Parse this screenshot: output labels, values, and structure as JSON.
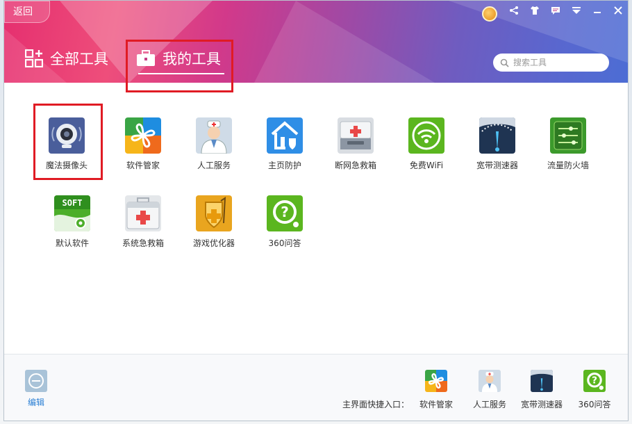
{
  "header": {
    "back_label": "返回",
    "tab_all": "全部工具",
    "tab_mine": "我的工具",
    "search_placeholder": "搜索工具"
  },
  "window_controls": [
    "medal-icon",
    "share-icon",
    "shirt-icon",
    "chat-icon",
    "menu-icon",
    "minimize-icon",
    "close-icon"
  ],
  "tools": [
    {
      "label": "魔法摄像头",
      "icon": "webcam-icon"
    },
    {
      "label": "软件管家",
      "icon": "software-manager-icon"
    },
    {
      "label": "人工服务",
      "icon": "doctor-icon"
    },
    {
      "label": "主页防护",
      "icon": "home-shield-icon"
    },
    {
      "label": "断网急救箱",
      "icon": "network-firstaid-icon"
    },
    {
      "label": "免费WiFi",
      "icon": "wifi-icon"
    },
    {
      "label": "宽带测速器",
      "icon": "speedometer-icon"
    },
    {
      "label": "流量防火墙",
      "icon": "traffic-firewall-icon"
    },
    {
      "label": "默认软件",
      "icon": "soft-icon"
    },
    {
      "label": "系统急救箱",
      "icon": "system-firstaid-icon"
    },
    {
      "label": "游戏优化器",
      "icon": "game-optimizer-icon"
    },
    {
      "label": "360问答",
      "icon": "qa-icon"
    }
  ],
  "footer": {
    "edit_label": "编辑",
    "quick_entry_label": "主界面快捷入口：",
    "quick_items": [
      {
        "label": "软件管家",
        "icon": "software-manager-icon"
      },
      {
        "label": "人工服务",
        "icon": "doctor-icon"
      },
      {
        "label": "宽带测速器",
        "icon": "speedometer-icon"
      },
      {
        "label": "360问答",
        "icon": "qa-icon"
      }
    ]
  },
  "colors": {
    "header_start": "#e52f6f",
    "header_end": "#4c6dd4",
    "highlight_box": "#e01b24",
    "link_blue": "#2a7fd4"
  }
}
